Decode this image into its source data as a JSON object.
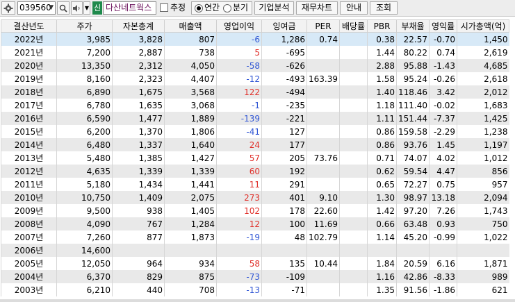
{
  "toolbar": {
    "code": "039560",
    "company": "다산네트웍스",
    "sin_badge": "신",
    "estimate_label": "추정",
    "annual_label": "연간",
    "quarter_label": "분기",
    "btn_analysis": "기업분석",
    "btn_chart": "재무차트",
    "btn_guide": "안내",
    "btn_search": "조회"
  },
  "table": {
    "headers": [
      "결산년도",
      "주가",
      "자본총계",
      "매출액",
      "영업이익",
      "잉여금",
      "PER",
      "배당률",
      "PBR",
      "부채율",
      "영익률",
      "시가총액(억)"
    ],
    "rows": [
      [
        "2022년",
        "3,985",
        "3,828",
        "807",
        "-6",
        "1,286",
        "0.74",
        "",
        "0.38",
        "22.57",
        "-0.70",
        "1,450"
      ],
      [
        "2021년",
        "7,200",
        "2,887",
        "738",
        "5",
        "-695",
        "",
        "",
        "1.44",
        "80.22",
        "0.74",
        "2,619"
      ],
      [
        "2020년",
        "13,350",
        "2,312",
        "4,050",
        "-58",
        "-626",
        "",
        "",
        "2.88",
        "95.88",
        "-1.43",
        "4,685"
      ],
      [
        "2019년",
        "8,160",
        "2,323",
        "4,407",
        "-12",
        "-493",
        "163.39",
        "",
        "1.58",
        "95.24",
        "-0.26",
        "2,618"
      ],
      [
        "2018년",
        "6,890",
        "1,675",
        "3,568",
        "122",
        "-494",
        "",
        "",
        "1.40",
        "118.46",
        "3.42",
        "2,012"
      ],
      [
        "2017년",
        "6,780",
        "1,635",
        "3,068",
        "-1",
        "-235",
        "",
        "",
        "1.18",
        "111.40",
        "-0.02",
        "1,683"
      ],
      [
        "2016년",
        "6,590",
        "1,477",
        "1,889",
        "-139",
        "-221",
        "",
        "",
        "1.11",
        "151.44",
        "-7.37",
        "1,425"
      ],
      [
        "2015년",
        "6,200",
        "1,370",
        "1,806",
        "-41",
        "127",
        "",
        "",
        "0.86",
        "159.58",
        "-2.29",
        "1,238"
      ],
      [
        "2014년",
        "6,480",
        "1,337",
        "1,640",
        "24",
        "177",
        "",
        "",
        "0.86",
        "93.76",
        "1.45",
        "1,197"
      ],
      [
        "2013년",
        "5,480",
        "1,385",
        "1,427",
        "57",
        "205",
        "73.76",
        "",
        "0.71",
        "74.07",
        "4.02",
        "1,012"
      ],
      [
        "2012년",
        "4,635",
        "1,339",
        "1,339",
        "60",
        "192",
        "",
        "",
        "0.62",
        "59.54",
        "4.47",
        "856"
      ],
      [
        "2011년",
        "5,180",
        "1,434",
        "1,441",
        "11",
        "291",
        "",
        "",
        "0.65",
        "72.27",
        "0.75",
        "957"
      ],
      [
        "2010년",
        "10,750",
        "1,409",
        "2,075",
        "273",
        "401",
        "9.10",
        "",
        "1.30",
        "98.97",
        "13.18",
        "2,094"
      ],
      [
        "2009년",
        "9,500",
        "938",
        "1,405",
        "102",
        "178",
        "22.60",
        "",
        "1.42",
        "97.20",
        "7.26",
        "1,743"
      ],
      [
        "2008년",
        "4,090",
        "767",
        "1,284",
        "12",
        "100",
        "11.69",
        "",
        "0.66",
        "63.48",
        "0.93",
        "750"
      ],
      [
        "2007년",
        "7,260",
        "877",
        "1,873",
        "-19",
        "48",
        "102.79",
        "",
        "1.14",
        "45.20",
        "-0.99",
        "1,022"
      ],
      [
        "2006년",
        "14,600",
        "",
        "",
        "",
        "",
        "",
        "",
        "",
        "",
        "",
        ""
      ],
      [
        "2005년",
        "12,050",
        "964",
        "934",
        "58",
        "135",
        "10.44",
        "",
        "1.84",
        "20.59",
        "6.16",
        "1,871"
      ],
      [
        "2004년",
        "6,370",
        "829",
        "875",
        "-73",
        "-109",
        "",
        "",
        "1.16",
        "42.86",
        "-8.33",
        "989"
      ],
      [
        "2003년",
        "6,210",
        "440",
        "708",
        "-13",
        "-71",
        "",
        "",
        "1.35",
        "91.56",
        "-1.86",
        "621"
      ]
    ]
  }
}
